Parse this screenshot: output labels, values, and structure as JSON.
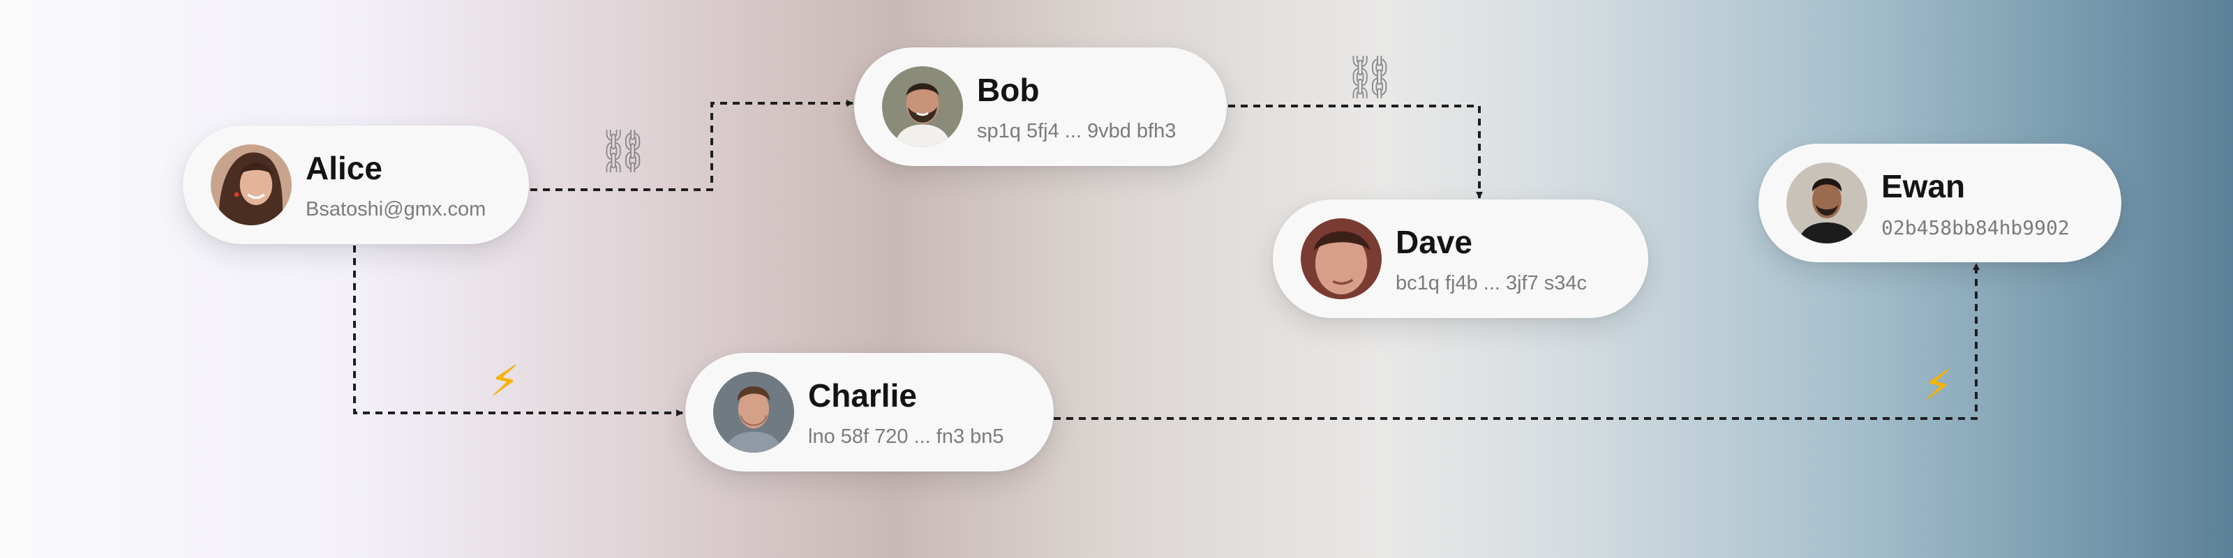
{
  "nodes": {
    "alice": {
      "name": "Alice",
      "address": "Bsatoshi@gmx.com"
    },
    "bob": {
      "name": "Bob",
      "address": "sp1q 5fj4 ... 9vbd bfh3"
    },
    "charlie": {
      "name": "Charlie",
      "address": "lno 58f 720 ... fn3 bn5"
    },
    "dave": {
      "name": "Dave",
      "address": "bc1q fj4b ... 3jf7 s34c"
    },
    "ewan": {
      "name": "Ewan",
      "address": "02b458bb84hb9902"
    }
  },
  "edges": [
    {
      "from": "Alice",
      "to": "Bob",
      "icon": "chain-link-icon"
    },
    {
      "from": "Bob",
      "to": "Dave",
      "icon": "chain-link-icon"
    },
    {
      "from": "Alice",
      "to": "Charlie",
      "icon": "lightning-bolt-icon"
    },
    {
      "from": "Charlie",
      "to": "Ewan",
      "icon": "lightning-bolt-icon"
    }
  ],
  "colors": {
    "card": "#f8f8f8",
    "connector": "#222222",
    "chain": "#8a8a8a",
    "bolt": "#f5b400"
  }
}
